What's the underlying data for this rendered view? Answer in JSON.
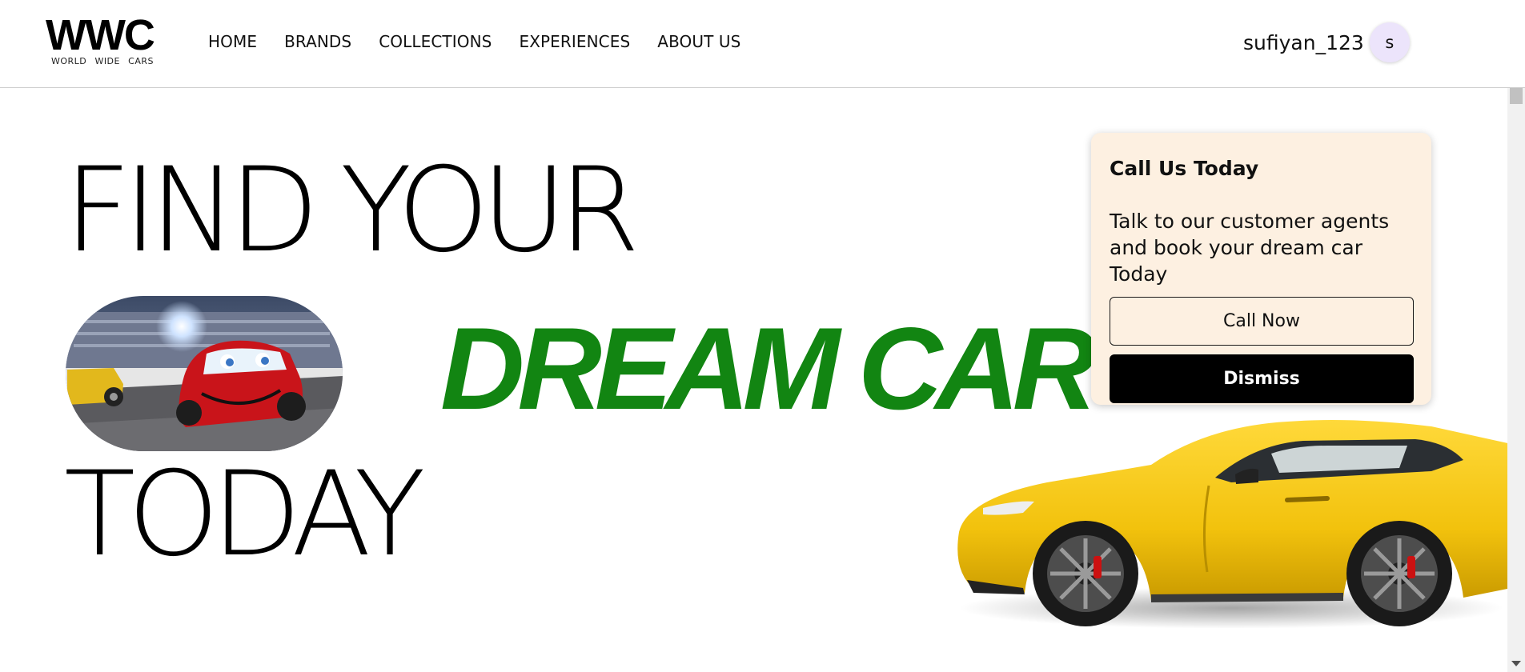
{
  "brand": {
    "logo": "WWC",
    "tagline": [
      "WORLD",
      "WIDE",
      "CARS"
    ]
  },
  "nav": {
    "items": [
      "HOME",
      "BRANDS",
      "COLLECTIONS",
      "EXPERIENCES",
      "ABOUT US"
    ]
  },
  "user": {
    "username": "sufiyan_123",
    "avatar_initial": "s"
  },
  "hero": {
    "line1": "FIND YOUR",
    "highlight": "DREAM CAR",
    "line3": "TODAY",
    "highlight_color": "#128512"
  },
  "call_card": {
    "title": "Call Us Today",
    "text": "Talk to our customer agents and book your dream car Today",
    "call_button": "Call Now",
    "dismiss_button": "Dismiss",
    "background": "#fdf0e1"
  },
  "icons": {
    "hero_image": "race-car-cartoon-image",
    "car_image": "yellow-sports-car-image"
  }
}
